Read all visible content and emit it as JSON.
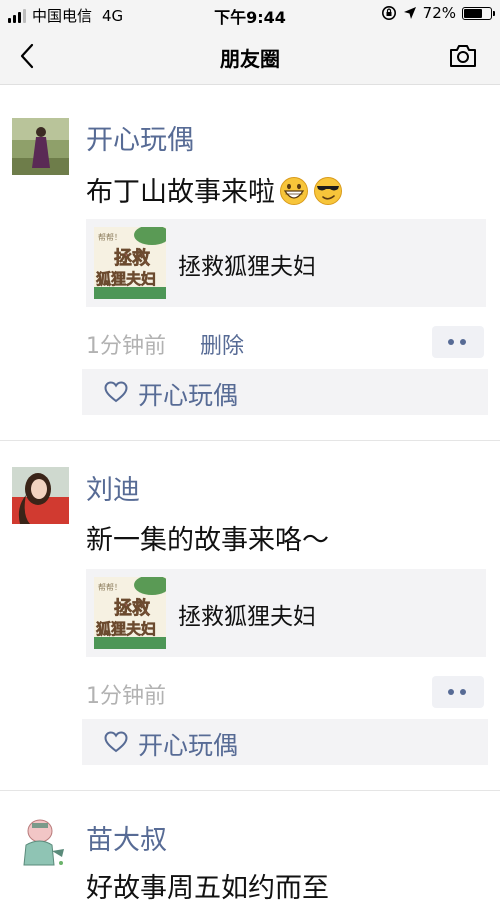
{
  "status_bar": {
    "carrier": "中国电信",
    "network": "4G",
    "time": "下午9:44",
    "battery": "72%",
    "battery_level": 0.72,
    "signal_bars": 3,
    "signal_total": 4
  },
  "nav": {
    "title": "朋友圈",
    "back_icon": "chevron-left-icon",
    "camera_icon": "camera-icon"
  },
  "colors": {
    "link": "#576b95",
    "meta": "#b2b2b2",
    "card_bg": "#f3f3f5"
  },
  "posts": [
    {
      "author": "开心玩偶",
      "text": "布丁山故事来啦",
      "emojis": [
        "grinning-face-icon",
        "cool-face-icon"
      ],
      "share": {
        "title": "拯救狐狸夫妇",
        "thumb_top": "帮帮！",
        "thumb_lines": [
          "拯救",
          "狐狸夫妇"
        ]
      },
      "time": "1分钟前",
      "delete": "删除",
      "likes": [
        "开心玩偶"
      ]
    },
    {
      "author": "刘迪",
      "text": "新一集的故事来咯～",
      "share": {
        "title": "拯救狐狸夫妇",
        "thumb_top": "帮帮！",
        "thumb_lines": [
          "拯救",
          "狐狸夫妇"
        ]
      },
      "time": "1分钟前",
      "likes": [
        "开心玩偶"
      ]
    },
    {
      "author": "苗大叔",
      "text": "好故事周五如约而至"
    }
  ]
}
